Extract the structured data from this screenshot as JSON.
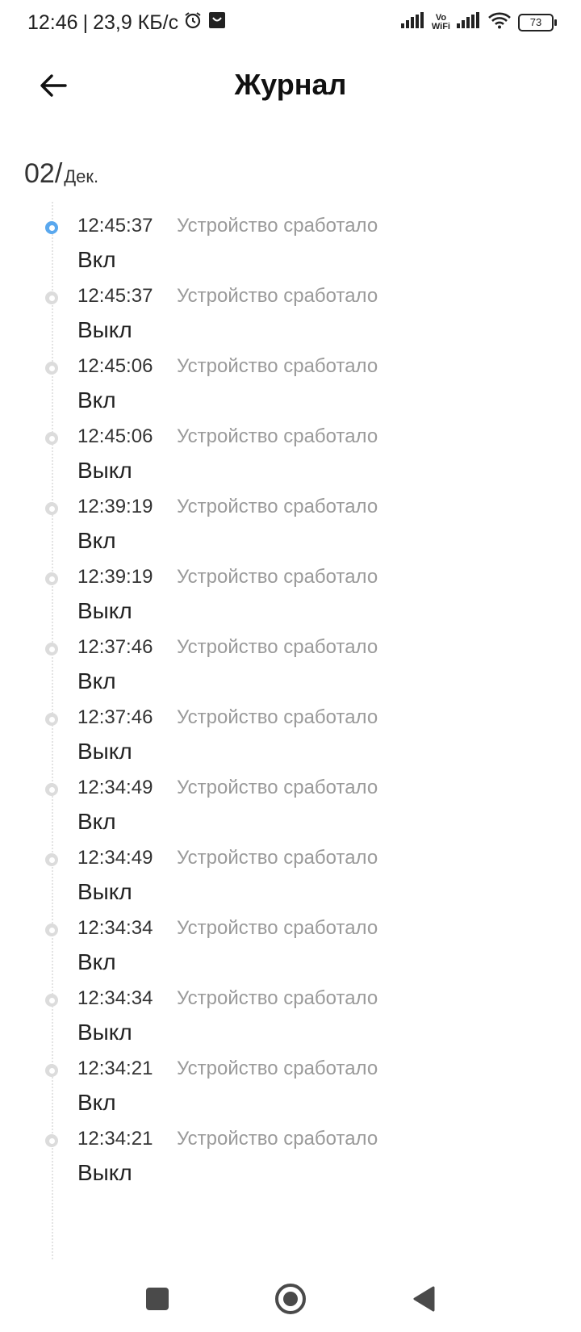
{
  "status_bar": {
    "time": "12:46",
    "separator": "|",
    "speed": "23,9 КБ/с",
    "vo_line1": "Vo",
    "vo_line2": "WiFi",
    "battery": "73"
  },
  "header": {
    "title": "Журнал"
  },
  "date": {
    "day": "02/",
    "month": "Дек."
  },
  "entries": [
    {
      "time": "12:45:37",
      "event": "Устройство сработало",
      "state": "Вкл"
    },
    {
      "time": "12:45:37",
      "event": "Устройство сработало",
      "state": "Выкл"
    },
    {
      "time": "12:45:06",
      "event": "Устройство сработало",
      "state": "Вкл"
    },
    {
      "time": "12:45:06",
      "event": "Устройство сработало",
      "state": "Выкл"
    },
    {
      "time": "12:39:19",
      "event": "Устройство сработало",
      "state": "Вкл"
    },
    {
      "time": "12:39:19",
      "event": "Устройство сработало",
      "state": "Выкл"
    },
    {
      "time": "12:37:46",
      "event": "Устройство сработало",
      "state": "Вкл"
    },
    {
      "time": "12:37:46",
      "event": "Устройство сработало",
      "state": "Выкл"
    },
    {
      "time": "12:34:49",
      "event": "Устройство сработало",
      "state": "Вкл"
    },
    {
      "time": "12:34:49",
      "event": "Устройство сработало",
      "state": "Выкл"
    },
    {
      "time": "12:34:34",
      "event": "Устройство сработало",
      "state": "Вкл"
    },
    {
      "time": "12:34:34",
      "event": "Устройство сработало",
      "state": "Выкл"
    },
    {
      "time": "12:34:21",
      "event": "Устройство сработало",
      "state": "Вкл"
    },
    {
      "time": "12:34:21",
      "event": "Устройство сработало",
      "state": "Выкл"
    }
  ],
  "colors": {
    "active_dot": "#5aa8ee",
    "inactive_dot": "#dcdcdc",
    "event_text": "#9a9a9a"
  },
  "icons": {
    "alarm": "alarm-clock-icon",
    "bag": "shopping-bag-icon",
    "signal": "signal-icon",
    "wifi": "wifi-icon",
    "back": "arrow-left-icon",
    "nav_recent": "square-icon",
    "nav_home": "circle-icon",
    "nav_back": "triangle-back-icon"
  }
}
